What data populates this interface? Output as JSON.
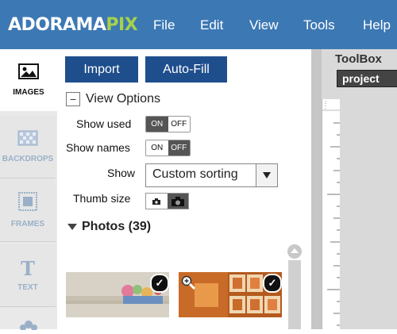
{
  "header": {
    "logo_part1": "ADORAMA",
    "logo_part2": "PIX",
    "menu": [
      "File",
      "Edit",
      "View",
      "Tools",
      "Help"
    ]
  },
  "tabs": [
    {
      "label": "IMAGES",
      "icon": "image-icon",
      "active": true
    },
    {
      "label": "BACKDROPS",
      "icon": "backdrop-icon",
      "active": false
    },
    {
      "label": "FRAMES",
      "icon": "frame-icon",
      "active": false
    },
    {
      "label": "TEXT",
      "icon": "text-icon",
      "active": false
    }
  ],
  "panel": {
    "import_label": "Import",
    "autofill_label": "Auto-Fill",
    "view_options_label": "View Options",
    "show_used_label": "Show used",
    "show_names_label": "Show names",
    "show_label": "Show",
    "show_value": "Custom sorting",
    "thumb_size_label": "Thumb size",
    "on_label": "ON",
    "off_label": "OFF",
    "show_used_state": "ON",
    "show_names_state": "OFF",
    "photos_header": "Photos (39)"
  },
  "toolbox": {
    "title": "ToolBox",
    "project_label": "project"
  },
  "colors": {
    "header_bg": "#3c78b4",
    "logo_accent": "#a6d24a",
    "button_bg": "#1f4e8c"
  }
}
